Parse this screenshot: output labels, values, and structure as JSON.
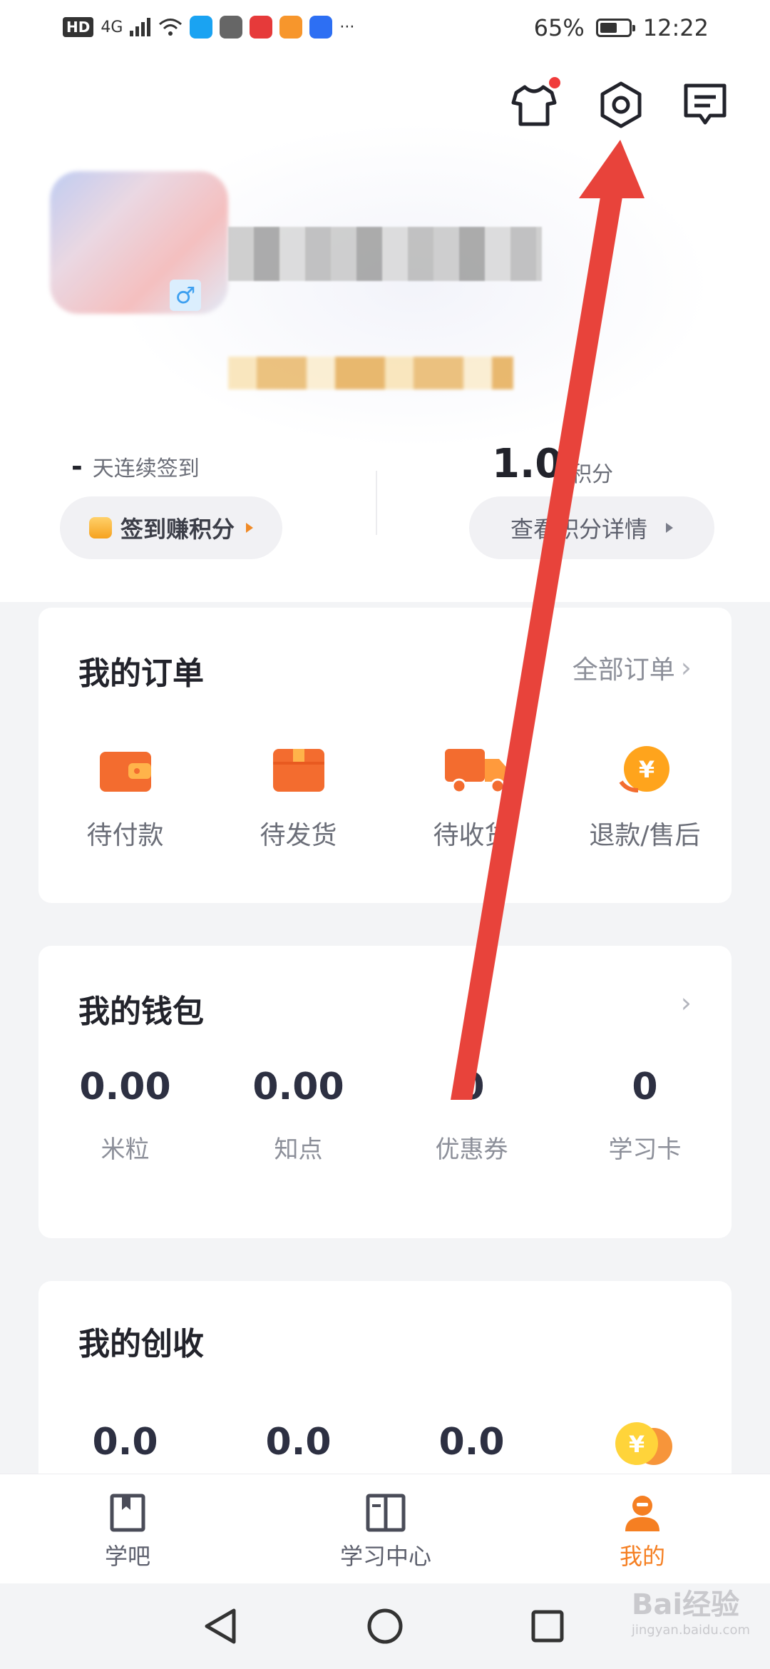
{
  "status_bar": {
    "left_badge": "HD",
    "network": "4G",
    "battery_percent": "65%",
    "battery_level": 0.65,
    "time": "12:22",
    "more": "···"
  },
  "header_icons": [
    "tshirt-icon",
    "settings-icon",
    "message-icon"
  ],
  "profile": {
    "gender_symbol": "♂"
  },
  "checkin": {
    "streak_count": "-",
    "streak_label": "天连续签到",
    "button_label": "签到赚积分"
  },
  "points": {
    "value": "1.0",
    "label": "积分",
    "detail_button": "查看积分详情"
  },
  "orders": {
    "title": "我的订单",
    "link": "全部订单",
    "items": [
      {
        "label": "待付款",
        "icon": "wallet-icon"
      },
      {
        "label": "待发货",
        "icon": "package-icon"
      },
      {
        "label": "待收货",
        "icon": "truck-icon"
      },
      {
        "label": "退款/售后",
        "icon": "refund-coin-icon"
      }
    ]
  },
  "wallet": {
    "title": "我的钱包",
    "items": [
      {
        "value": "0.00",
        "label": "米粒"
      },
      {
        "value": "0.00",
        "label": "知点"
      },
      {
        "value": "0",
        "label": "优惠券"
      },
      {
        "value": "0",
        "label": "学习卡"
      }
    ]
  },
  "income": {
    "title": "我的创收",
    "values": [
      "0.0",
      "0.0",
      "0.0"
    ],
    "coin_symbol": "¥"
  },
  "nav": {
    "items": [
      {
        "label": "学吧",
        "active": false
      },
      {
        "label": "学习中心",
        "active": false
      },
      {
        "label": "我的",
        "active": true
      }
    ]
  },
  "colors": {
    "accent": "#f57f22",
    "arrow": "#e8433b",
    "text_primary": "#22232b",
    "text_secondary": "#8c8f99"
  },
  "watermark": {
    "brand": "Bai经验",
    "url": "jingyan.baidu.com"
  }
}
